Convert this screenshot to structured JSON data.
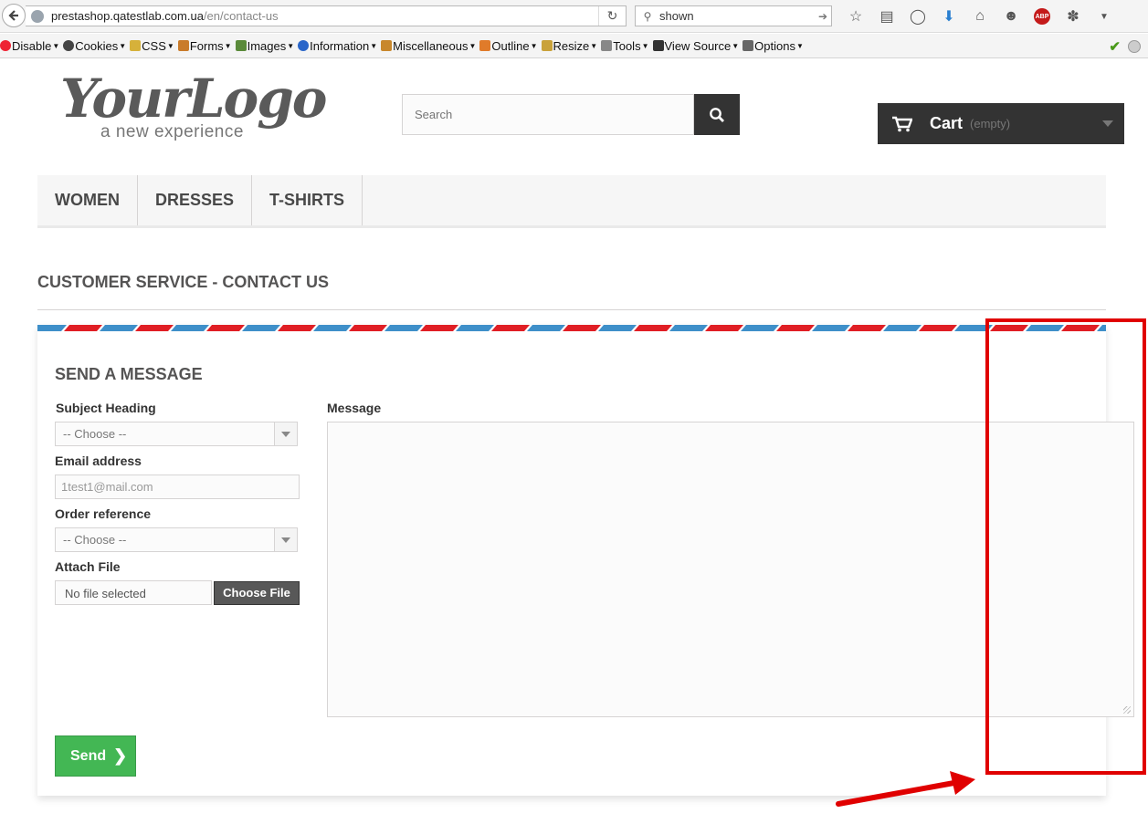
{
  "browser": {
    "url_host": "prestashop.qatestlab.com.ua",
    "url_path": "/en/contact-us",
    "search_value": "shown",
    "toolbar_icons": [
      "star-icon",
      "reading-list-icon",
      "pocket-icon",
      "download-icon",
      "home-icon",
      "chat-icon",
      "adblock-icon",
      "bug-icon",
      "menu-icon"
    ],
    "abp_label": "ABP"
  },
  "web_developer_bar": {
    "items": [
      "Disable",
      "Cookies",
      "CSS",
      "Forms",
      "Images",
      "Information",
      "Miscellaneous",
      "Outline",
      "Resize",
      "Tools",
      "View Source",
      "Options"
    ]
  },
  "shop": {
    "logo_main": "YourLogo",
    "logo_sub": "a new experience",
    "search_placeholder": "Search",
    "cart_label": "Cart",
    "cart_status": "(empty)",
    "menu": [
      "WOMEN",
      "DRESSES",
      "T-SHIRTS"
    ],
    "page_heading": "CUSTOMER SERVICE - CONTACT US"
  },
  "form": {
    "title": "SEND A MESSAGE",
    "subject_label": "Subject Heading",
    "subject_value": "-- Choose --",
    "email_label": "Email address",
    "email_value": "1test1@mail.com",
    "order_label": "Order reference",
    "order_value": "-- Choose --",
    "file_label": "Attach File",
    "file_name": "No file selected",
    "file_button": "Choose File",
    "message_label": "Message",
    "message_value": "",
    "send_label": "Send"
  },
  "colors": {
    "accent_green": "#43b754",
    "stripe_red": "#e01e24",
    "stripe_blue": "#3e8fc9",
    "annotation_red": "#e00000"
  }
}
